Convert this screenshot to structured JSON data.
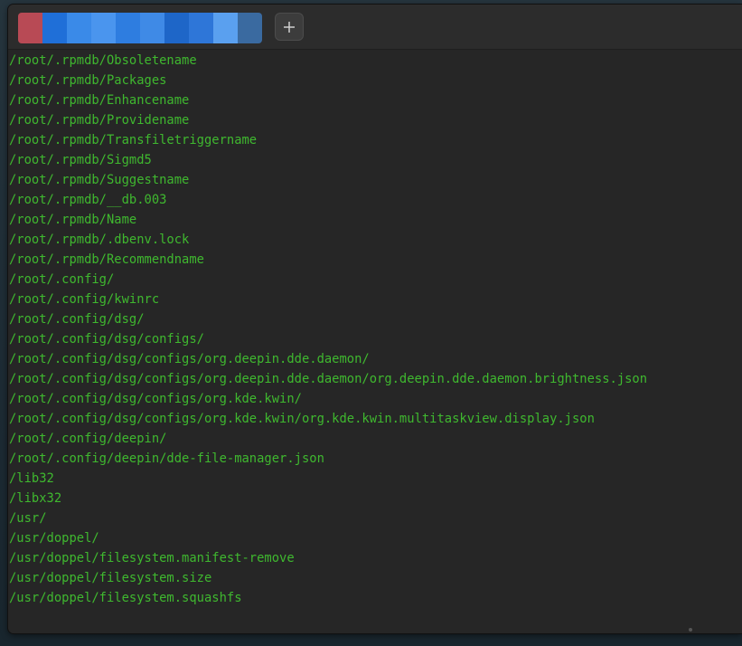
{
  "colors": {
    "terminal_background": "#262626",
    "terminal_text": "#3fb82f",
    "tabbar_background": "#2c2c2c",
    "add_button_background": "#3c3c3c"
  },
  "tabbar": {
    "active_tab": {
      "label": "",
      "obscured": true,
      "mosaic_colors": [
        "#b84a55",
        "#1f6fd8",
        "#3a8ae8",
        "#4a95ee",
        "#2e7de0",
        "#3f8ae6",
        "#1e66c8",
        "#2e76d8",
        "#5aa0ef",
        "#3a6aa0"
      ]
    },
    "add_tab": {
      "icon": "plus-icon"
    }
  },
  "terminal": {
    "lines": [
      "/root/.rpmdb/Obsoletename",
      "/root/.rpmdb/Packages",
      "/root/.rpmdb/Enhancename",
      "/root/.rpmdb/Providename",
      "/root/.rpmdb/Transfiletriggername",
      "/root/.rpmdb/Sigmd5",
      "/root/.rpmdb/Suggestname",
      "/root/.rpmdb/__db.003",
      "/root/.rpmdb/Name",
      "/root/.rpmdb/.dbenv.lock",
      "/root/.rpmdb/Recommendname",
      "/root/.config/",
      "/root/.config/kwinrc",
      "/root/.config/dsg/",
      "/root/.config/dsg/configs/",
      "/root/.config/dsg/configs/org.deepin.dde.daemon/",
      "/root/.config/dsg/configs/org.deepin.dde.daemon/org.deepin.dde.daemon.brightness.json",
      "/root/.config/dsg/configs/org.kde.kwin/",
      "/root/.config/dsg/configs/org.kde.kwin/org.kde.kwin.multitaskview.display.json",
      "/root/.config/deepin/",
      "/root/.config/deepin/dde-file-manager.json",
      "/lib32",
      "/libx32",
      "/usr/",
      "/usr/doppel/",
      "/usr/doppel/filesystem.manifest-remove",
      "/usr/doppel/filesystem.size",
      "/usr/doppel/filesystem.squashfs"
    ]
  }
}
